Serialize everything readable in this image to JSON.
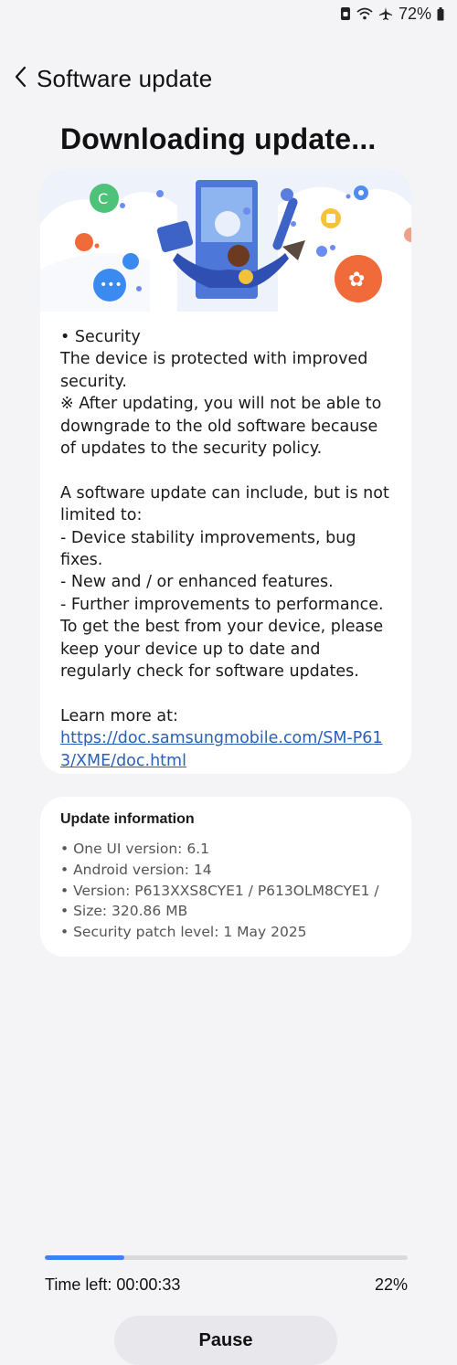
{
  "status": {
    "battery": "72%",
    "icons": [
      "phone-lock-icon",
      "wifi-icon",
      "airplane-mode-icon",
      "battery-icon"
    ]
  },
  "header": {
    "title": "Software update",
    "back_icon": "chevron-left-icon"
  },
  "page_title": "Downloading update...",
  "notes": {
    "security_heading": "• Security",
    "security_body": "The device is protected with improved security.",
    "security_note": "※ After updating, you will not be able to downgrade to the old software because of updates to the security policy.",
    "intro": "A software update can include, but is not limited to:",
    "items": [
      " - Device stability improvements, bug fixes.",
      " - New and / or enhanced features.",
      " - Further improvements to performance."
    ],
    "advice": "To get the best from your device, please keep your device up to date and regularly check for software updates.",
    "learn_more": "Learn more at:",
    "link": "https://doc.samsungmobile.com/SM-P613/XME/doc.html"
  },
  "update_info": {
    "title": "Update information",
    "lines": [
      "• One UI version: 6.1",
      "• Android version: 14",
      "• Version: P613XXS8CYE1 / P613OLM8CYE1 /",
      "• Size: 320.86 MB",
      "• Security patch level: 1 May 2025"
    ]
  },
  "progress": {
    "fraction": 0.22,
    "time_left": "Time left: 00:00:33",
    "percent": "22%"
  },
  "pause_label": "Pause",
  "colors": {
    "accent": "#3e82f0",
    "link": "#2b5fb8",
    "background": "#f4f4f6"
  }
}
